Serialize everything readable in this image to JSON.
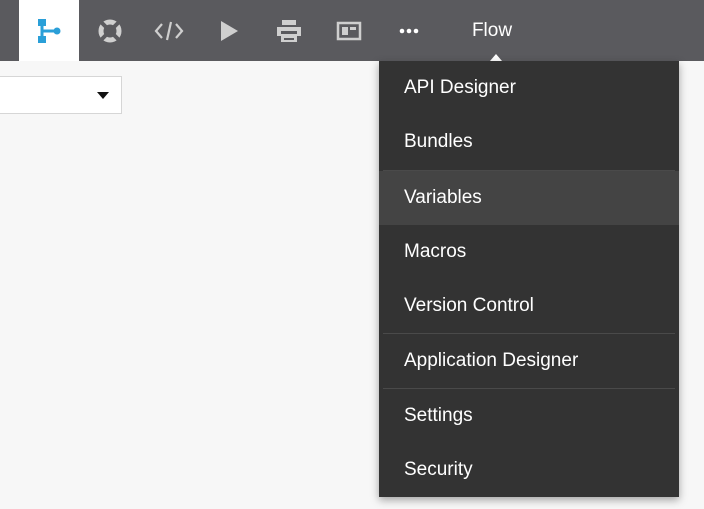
{
  "toolbar": {
    "flow_label": "Flow",
    "buttons": [
      {
        "icon": "flow-diagram-icon",
        "active": true
      },
      {
        "icon": "lifebuoy-icon",
        "active": false
      },
      {
        "icon": "code-icon",
        "active": false
      },
      {
        "icon": "play-icon",
        "active": false
      },
      {
        "icon": "printer-icon",
        "active": false
      },
      {
        "icon": "layout-panel-icon",
        "active": false
      },
      {
        "icon": "more-dots-icon",
        "active": false
      }
    ]
  },
  "menu": {
    "items": [
      {
        "label": "API Designer"
      },
      {
        "label": "Bundles"
      },
      {
        "label": "Variables",
        "highlighted": true
      },
      {
        "label": "Macros"
      },
      {
        "label": "Version Control"
      },
      {
        "label": "Application Designer"
      },
      {
        "label": "Settings"
      },
      {
        "label": "Security"
      }
    ]
  },
  "colors": {
    "toolbar_bg": "#5a5a5e",
    "menu_bg": "#333333",
    "menu_highlight": "#444444",
    "accent": "#2a9fd8",
    "icon_gray": "#cfcfcf"
  }
}
